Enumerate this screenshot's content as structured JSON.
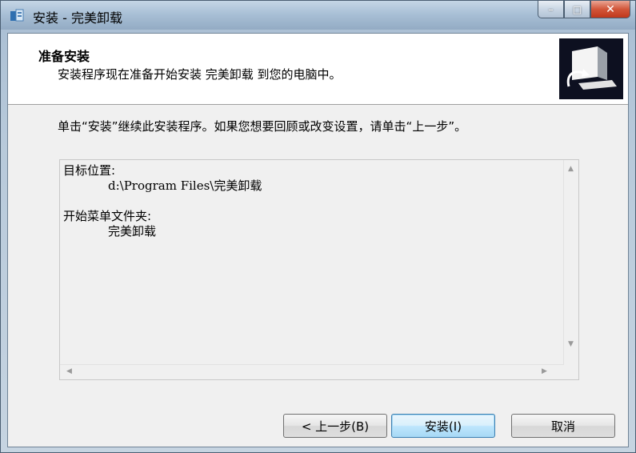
{
  "window": {
    "title": "安装 - 完美卸载",
    "buttons": {
      "minimize": "–",
      "maximize": "□",
      "close": "✕"
    }
  },
  "header": {
    "title": "准备安装",
    "subtitle": "安装程序现在准备开始安装 完美卸载 到您的电脑中。"
  },
  "intro": "单击“安装”继续此安装程序。如果您想要回顾或改变设置，请单击“上一步”。",
  "memo": {
    "dest_label": "目标位置:",
    "dest_value": "d:\\Program Files\\完美卸载",
    "startmenu_label": "开始菜单文件夹:",
    "startmenu_value": "完美卸载"
  },
  "buttons": {
    "back": "< 上一步(B)",
    "install": "安装(I)",
    "cancel": "取消"
  }
}
